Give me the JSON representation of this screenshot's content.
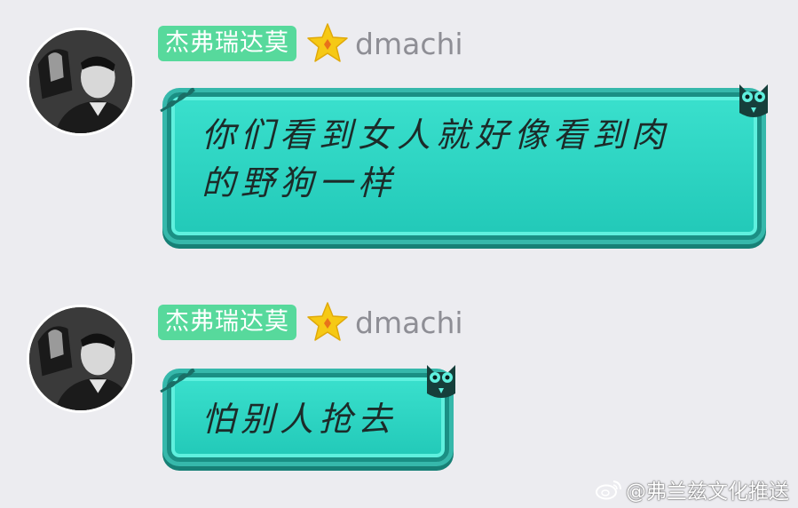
{
  "messages": [
    {
      "display_name": "杰弗瑞达莫",
      "username": "dmachi",
      "text": "你们看到女人就好像看到肉的野狗一样"
    },
    {
      "display_name": "杰弗瑞达莫",
      "username": "dmachi",
      "text": "怕别人抢去"
    }
  ],
  "watermark": {
    "text": "@弗兰兹文化推送"
  },
  "colors": {
    "background": "#ececf0",
    "name_tag": "#57d99c",
    "bubble_fill": "#2dd5c3",
    "bubble_border": "#1a8f84",
    "star": "#f6c915"
  },
  "icons": [
    "avatar-photo",
    "star-icon",
    "owl-icon",
    "leaf-decoration",
    "weibo-icon"
  ]
}
